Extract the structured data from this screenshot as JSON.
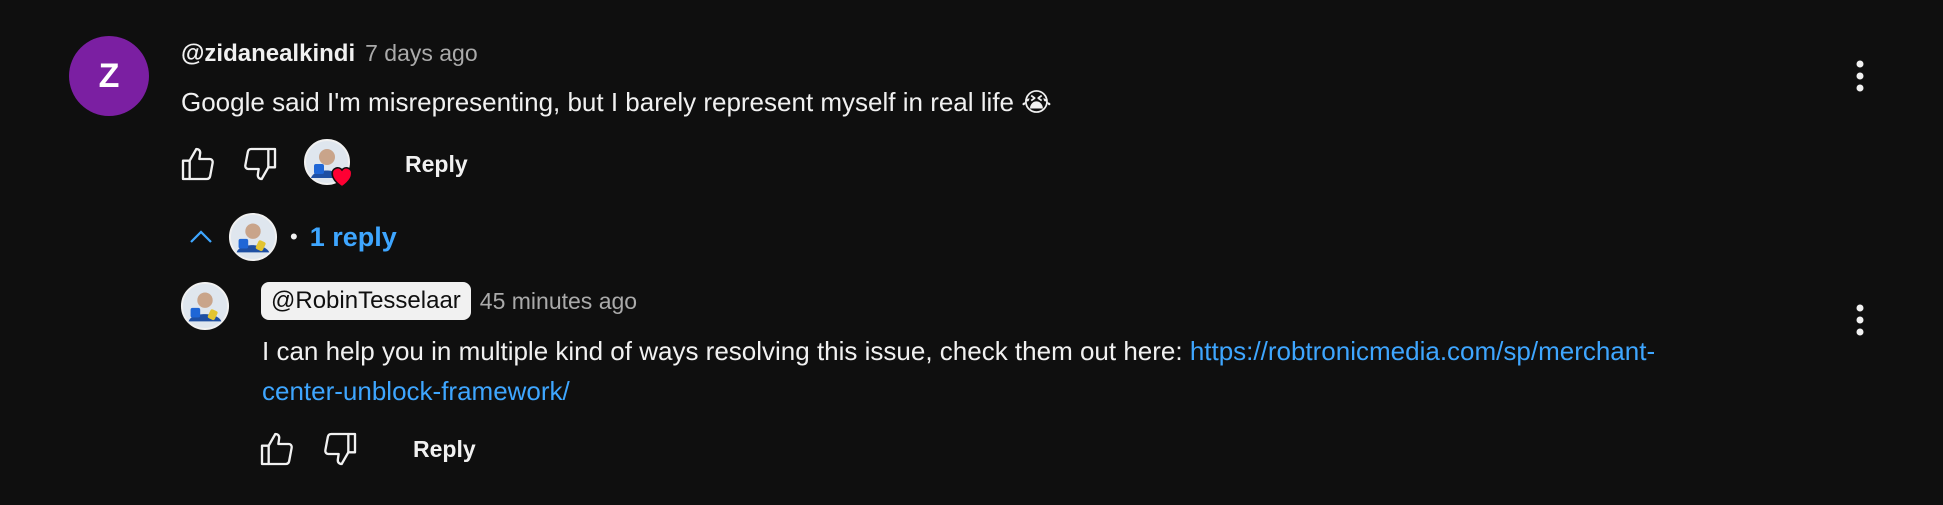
{
  "comment": {
    "avatar_letter": "Z",
    "avatar_color": "#7b1fa2",
    "author": "@zidanealkindi",
    "time": "7 days ago",
    "text": "Google said I'm misrepresenting, but I barely represent myself in real life 😭",
    "reply_label": "Reply",
    "like_icon": "thumb-up-icon",
    "dislike_icon": "thumb-down-icon",
    "creator_heart_icon": "creator-heart-icon",
    "menu_icon": "more-vert-icon"
  },
  "replies_toggle": {
    "chevron_icon": "chevron-up-icon",
    "separator": "•",
    "label": "1 reply"
  },
  "reply": {
    "author": "@RobinTesselaar",
    "time": "45 minutes ago",
    "text_before_link": "I can help you in multiple kind of ways resolving this issue, check them out here: ",
    "link_line1": "https://robtronicmedia.com/sp/merchant-",
    "link_line2": "center-unblock-framework/",
    "reply_label": "Reply",
    "menu_icon": "more-vert-icon"
  },
  "colors": {
    "background": "#0f0f0f",
    "text": "#f1f1f1",
    "muted": "#aaaaaa",
    "link": "#3ea6ff",
    "heart": "#ff0033"
  }
}
